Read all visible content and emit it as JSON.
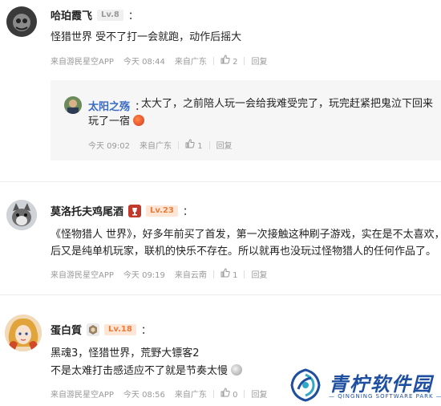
{
  "comments": [
    {
      "name": "哈珀霞飞",
      "level": "Lv.8",
      "text": "怪猎世界 受不了打一会就跑，动作后摇大",
      "source": "来自游民星空APP",
      "time": "今天 08:44",
      "location": "来自广东",
      "likes": "2",
      "reply_label": "回复",
      "reply": {
        "name": "太阳之殇",
        "text_line1": "太大了，之前陪人玩一会给我难受完了，玩完赶紧把鬼泣下回来",
        "text_line2": "玩了一宿",
        "time": "今天 09:02",
        "location": "来自广东",
        "likes": "1",
        "reply_label": "回复"
      }
    },
    {
      "name": "莫洛托夫鸡尾酒",
      "level": "Lv.23",
      "text_line1": "《怪物猎人 世界》，好多年前买了首发，第一次接触这种刷子游戏，实在是不太喜欢，然",
      "text_line2": "后又是纯单机玩家，联机的快乐不存在。所以就再也没玩过怪物猎人的任何作品了。",
      "source": "来自游民星空APP",
      "time": "今天 09:19",
      "location": "来自云南",
      "likes": "1",
      "reply_label": "回复"
    },
    {
      "name": "蛋白質",
      "level": "Lv.18",
      "text_line1": "黑魂3，怪猎世界，荒野大镖客2",
      "text_line2": "不是太难打击感适应不了就是节奏太慢",
      "source": "来自游民星空APP",
      "time": "今天 08:56",
      "location": "来自广东",
      "likes": "0",
      "reply_label": "回复"
    }
  ],
  "watermark": {
    "title": "青柠软件园",
    "subtitle": "— QINGNING SOFTWARE PARK —"
  },
  "colors": {
    "name_blue": "#3b6cc4",
    "level_orange": "#ee7a3a",
    "meta_gray": "#999999",
    "watermark_blue": "#1e4fa0"
  }
}
